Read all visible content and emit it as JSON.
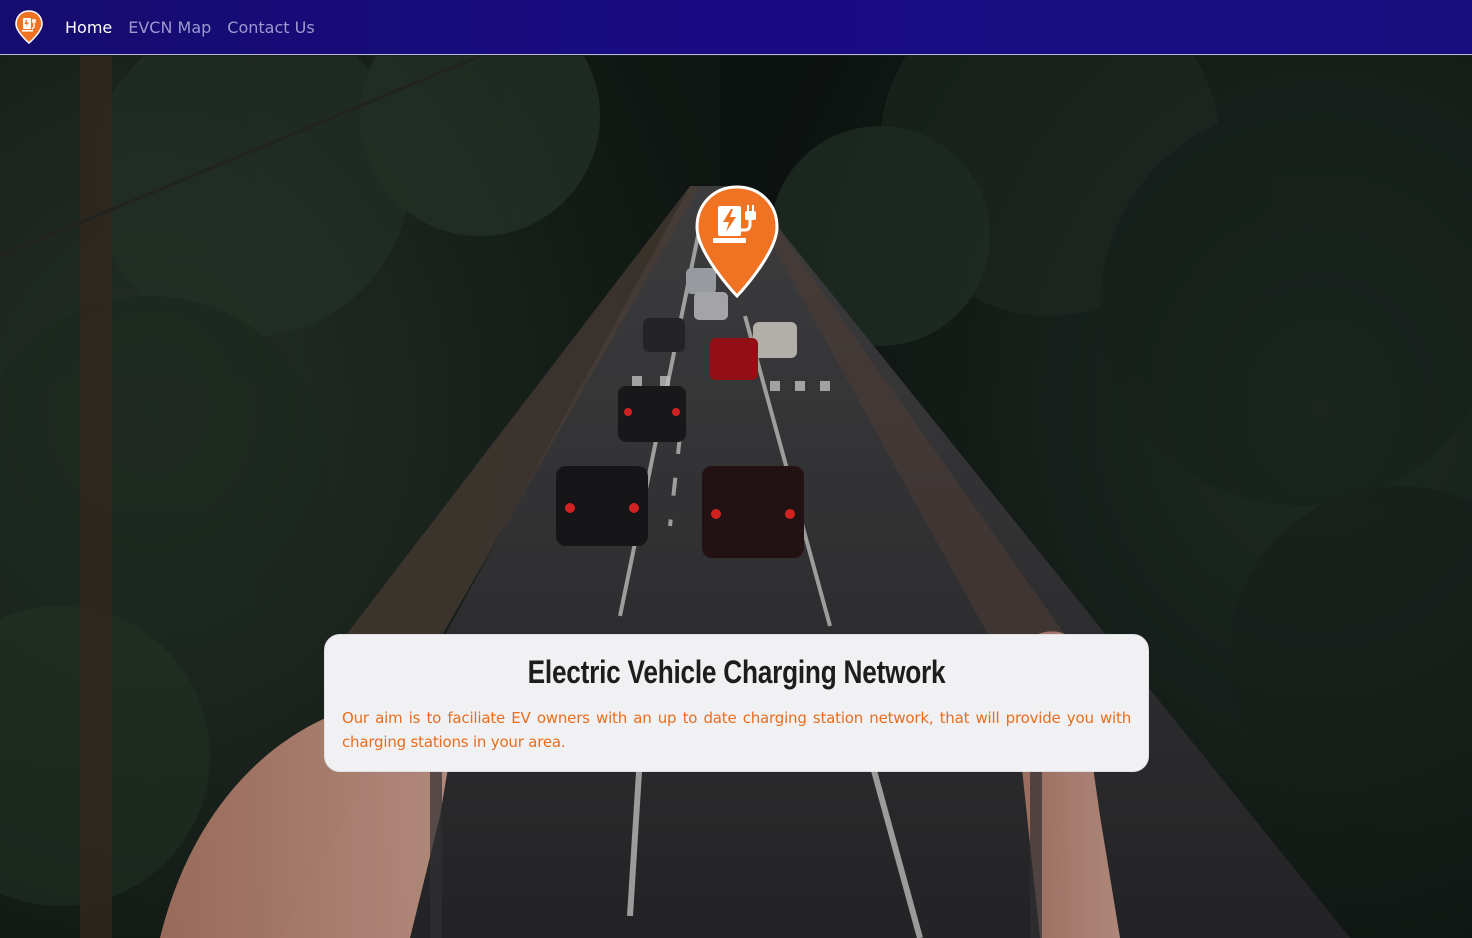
{
  "navbar": {
    "brand_icon": "ev-charging-pin-icon",
    "links": [
      {
        "label": "Home",
        "active": true
      },
      {
        "label": "EVCN Map",
        "active": false
      },
      {
        "label": "Contact Us",
        "active": false
      }
    ]
  },
  "hero": {
    "background_image": "tree-lined-road-with-cars-held-phone-photo",
    "pin_icon": "ev-charging-station-pin-icon"
  },
  "card": {
    "title": "Electric Vehicle Charging Network",
    "text": "Our aim is to faciliate EV owners with an up to date charging station network, that will provide you with charging stations in your area."
  },
  "colors": {
    "navbar_bg": "#1a0b85",
    "accent_orange": "#ef7323",
    "card_bg": "#f1f1f3",
    "nav_active": "#ffffff",
    "nav_inactive": "#9d9ad0"
  }
}
